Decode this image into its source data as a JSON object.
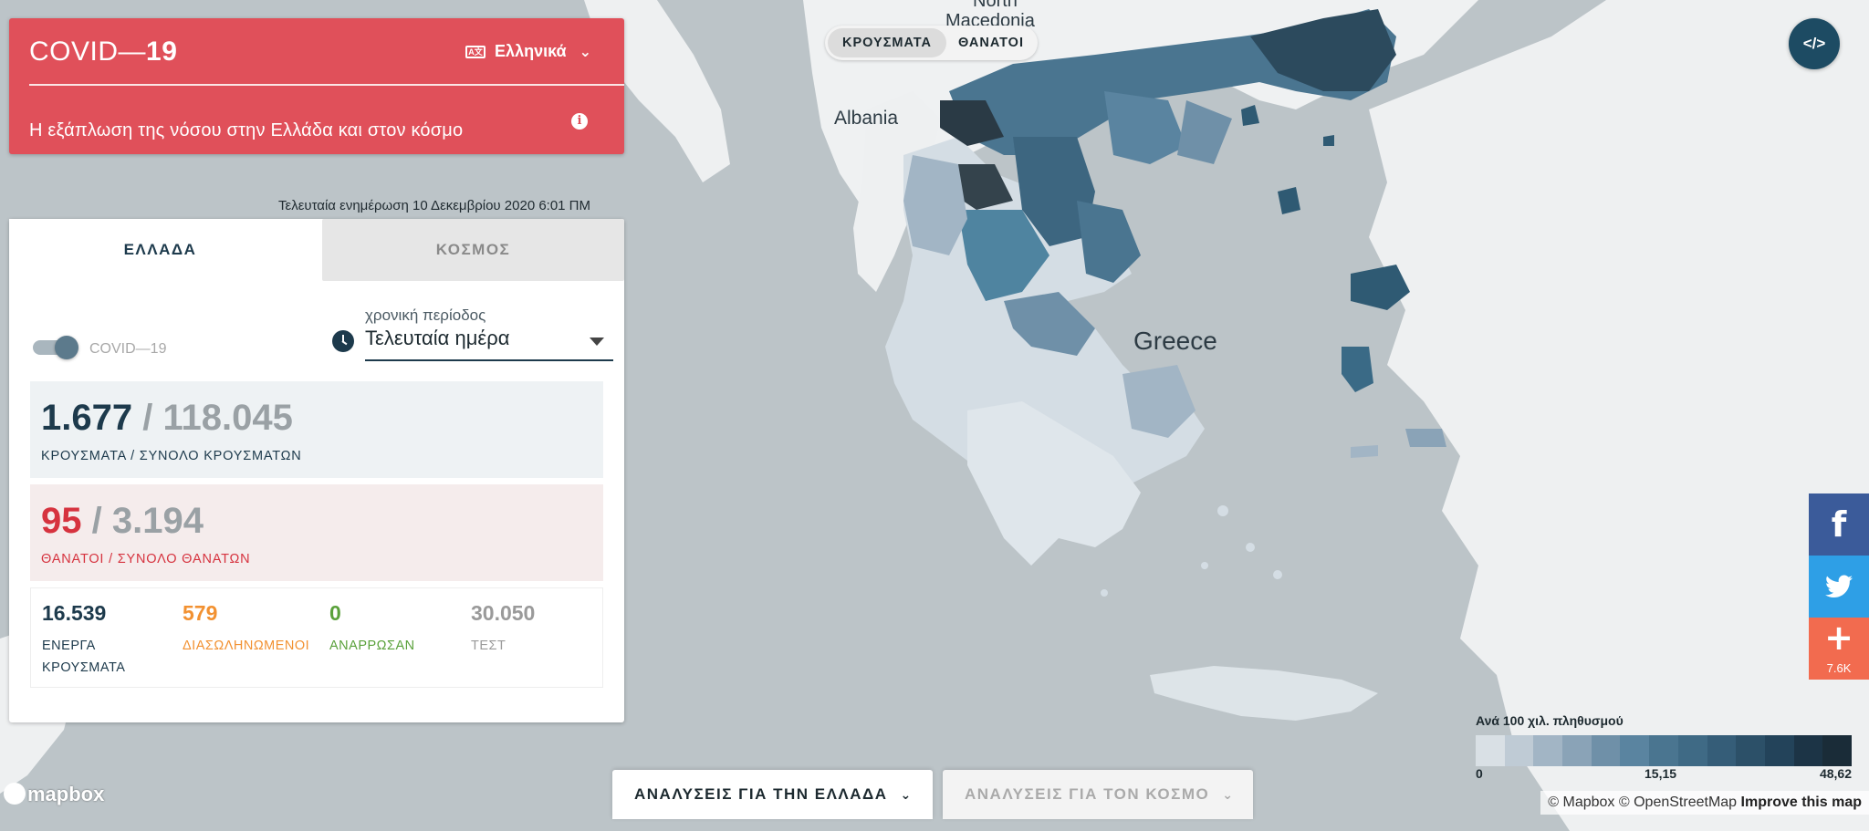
{
  "header": {
    "brand_light": "COVID—",
    "brand_bold": "19",
    "language": "Ελληνικά",
    "subtitle": "Η εξάπλωση της νόσου στην Ελλάδα και στον κόσμο"
  },
  "last_updated": "Τελευταία ενημέρωση 10 Δεκεμβρίου 2020 6:01 ΠΜ",
  "tabs": [
    {
      "label": "ΕΛΛΑΔΑ"
    },
    {
      "label": "ΚΟΣΜΟΣ"
    }
  ],
  "toggle": {
    "label": "COVID—19",
    "on": true
  },
  "period": {
    "label": "χρονική περίοδος",
    "value": "Τελευταία ημέρα"
  },
  "cases": {
    "now": "1.677",
    "sep": " / ",
    "total": "118.045",
    "caption": "ΚΡΟΥΣΜΑΤΑ / ΣΥΝΟΛΟ ΚΡΟΥΣΜΑΤΩΝ"
  },
  "deaths": {
    "now": "95",
    "sep": " / ",
    "total": "3.194",
    "caption": "ΘΑΝΑΤΟΙ / ΣΥΝΟΛΟ ΘΑΝΑΤΩΝ"
  },
  "small_stats": {
    "active": {
      "value": "16.539",
      "label": "ΕΝΕΡΓΑ ΚΡΟΥΣΜΑΤΑ"
    },
    "icu": {
      "value": "579",
      "label": "ΔΙΑΣΩΛΗΝΩΜΕΝΟΙ"
    },
    "recovered": {
      "value": "0",
      "label": "ΑΝΑΡΡΩΣΑΝ"
    },
    "tests": {
      "value": "30.050",
      "label": "ΤΕΣΤ"
    }
  },
  "metric_switch": {
    "cases": "ΚΡΟΥΣΜΑΤΑ",
    "deaths": "ΘΑΝΑΤΟΙ"
  },
  "embed_label": "</>",
  "map_labels": {
    "north": "North",
    "macedonia": "Macedonia",
    "albania": "Albania",
    "greece": "Greece"
  },
  "share": {
    "more_count": "7.6K"
  },
  "legend": {
    "title": "Ανά 100 χιλ. πληθυσμού",
    "min": "0",
    "mid": "15,15",
    "max": "48,62",
    "colors": [
      "#d9e0e5",
      "#bfcbd5",
      "#a2b5c5",
      "#8aa3b7",
      "#6f90a8",
      "#5a84a0",
      "#4a7590",
      "#3f6a85",
      "#355d78",
      "#2c5068",
      "#23435a",
      "#1c3446",
      "#1a2c38"
    ]
  },
  "attribution": {
    "mapbox": "© Mapbox",
    "osm": "© OpenStreetMap",
    "improve": "Improve this map"
  },
  "mapbox_logo": "mapbox",
  "bottom_buttons": {
    "greece": "ΑΝΑΛΥΣΕΙΣ ΓΙΑ ΤΗΝ ΕΛΛΑΔΑ",
    "world": "ΑΝΑΛΥΣΕΙΣ ΓΙΑ ΤΟΝ ΚΟΣΜΟ"
  }
}
